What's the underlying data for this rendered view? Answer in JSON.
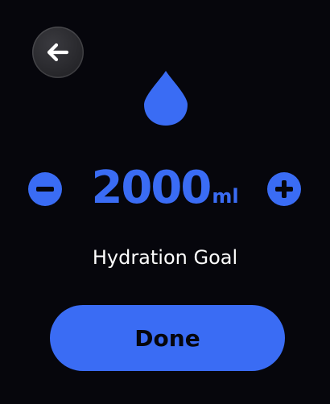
{
  "colors": {
    "background": "#06060c",
    "accent": "#3a6cf4",
    "text": "#ffffff",
    "back_button_bg": "#2a2a2e"
  },
  "header": {
    "back_icon": "arrow-left-icon"
  },
  "hero": {
    "icon": "water-drop-icon"
  },
  "stepper": {
    "value": "2000",
    "unit": "ml",
    "decrement_icon": "minus-circle-icon",
    "increment_icon": "plus-circle-icon"
  },
  "goal": {
    "label": "Hydration Goal"
  },
  "actions": {
    "done_label": "Done"
  }
}
